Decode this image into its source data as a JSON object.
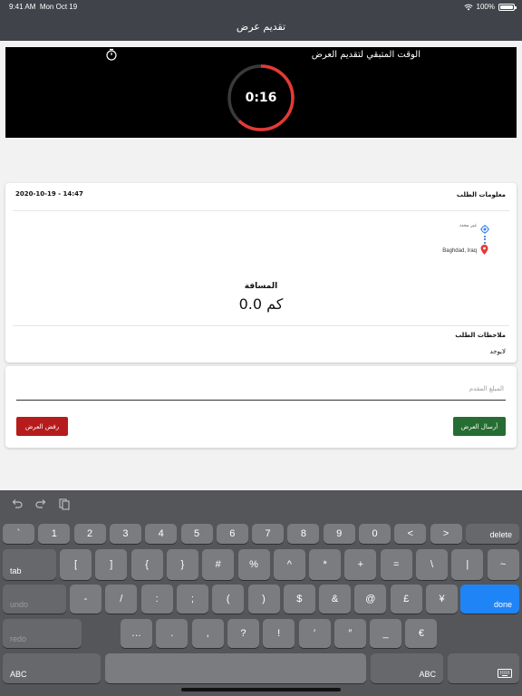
{
  "status_bar": {
    "time": "9:41 AM",
    "date": "Mon Oct 19",
    "battery": "100%",
    "battery_level": 1.0
  },
  "nav": {
    "title": "تقديم عرض"
  },
  "timer": {
    "title": "الوقت المتبقي لتقديم العرض",
    "value": "0:16",
    "progress": 0.62,
    "ring_color": "#e53935",
    "track_color": "#3a3a3a"
  },
  "order_info": {
    "section_label": "معلومات الطلب",
    "datetime": "2020-10-19 - 14:47",
    "from": "غير محدد",
    "to": "Baghdad, Iraq",
    "distance_label": "المسافة",
    "distance_value": "0.0 كم",
    "notes_label": "ملاحظات الطلب",
    "notes_value": "لايوجد"
  },
  "offer": {
    "amount_placeholder": "المبلغ المقدم",
    "send_label": "أرسال العرض",
    "reject_label": "رفض العرض"
  },
  "colors": {
    "send_button": "#256d32",
    "reject_button": "#b71c1c",
    "origin_icon": "#2f80ed",
    "destination_icon": "#e53935"
  },
  "keyboard": {
    "row1": [
      "`",
      "1",
      "2",
      "3",
      "4",
      "5",
      "6",
      "7",
      "8",
      "9",
      "0",
      "<",
      ">"
    ],
    "row1_delete": "delete",
    "row2_tab": "tab",
    "row2": [
      "[",
      "]",
      "{",
      "}",
      "#",
      "%",
      "^",
      "*",
      "+",
      "=",
      "\\",
      "|",
      "~"
    ],
    "row3_undo": "undo",
    "row3": [
      "-",
      "/",
      ":",
      ";",
      "(",
      ")",
      "$",
      "&",
      "@",
      "£",
      "¥"
    ],
    "row3_done": "done",
    "row4_redo": "redo",
    "row4": [
      "…",
      ".",
      ",",
      "?",
      "!",
      "′",
      "″",
      "_",
      "€"
    ],
    "row5_abc_left": "ABC",
    "row5_abc_right": "ABC"
  }
}
